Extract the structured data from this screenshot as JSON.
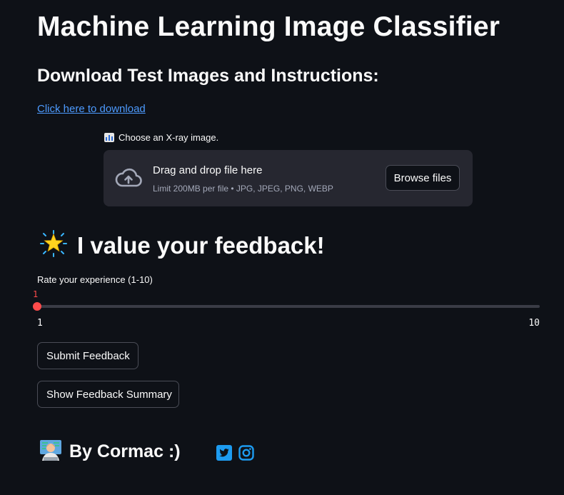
{
  "title": "Machine Learning Image Classifier",
  "subtitle": "Download Test Images and Instructions:",
  "download_link": "Click here to download",
  "uploader": {
    "label_emoji": "chart-emoji",
    "label": "Choose an X-ray image.",
    "drop_text": "Drag and drop file here",
    "limit_text": "Limit 200MB per file • JPG, JPEG, PNG, WEBP",
    "browse_label": "Browse files",
    "icon": "cloud-upload-icon"
  },
  "feedback": {
    "emoji": "glowing-star-icon",
    "heading": "I value your feedback!",
    "slider": {
      "label": "Rate your experience (1-10)",
      "value": "1",
      "min": "1",
      "max": "10"
    },
    "submit_label": "Submit Feedback",
    "summary_label": "Show Feedback Summary"
  },
  "footer": {
    "emoji": "technologist-icon",
    "byline": "By Cormac :)",
    "socials": [
      "twitter-icon",
      "instagram-icon"
    ]
  },
  "colors": {
    "background": "#0e1117",
    "panel": "#262730",
    "accent": "#ff4b4b",
    "link": "#4d9bff",
    "social": "#1d9bf0"
  }
}
